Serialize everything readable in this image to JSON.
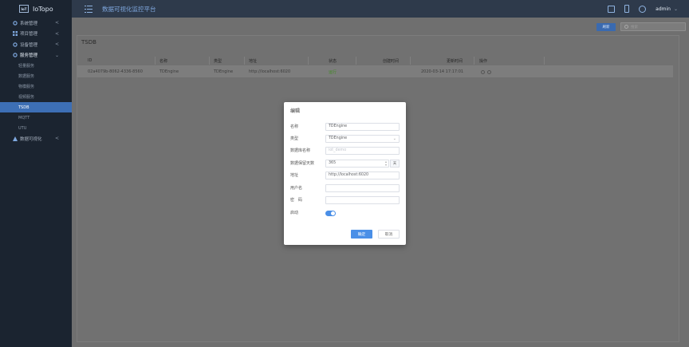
{
  "app": {
    "logo_badge": "IoT",
    "name": "IoTopo"
  },
  "header": {
    "title": "数据可视化监控平台",
    "user": "admin",
    "icons": [
      "monitor-icon",
      "phone-icon",
      "globe-icon"
    ]
  },
  "sidebar": {
    "items": [
      {
        "label": "系统管理",
        "icon": "gear-icon",
        "chevron": "<"
      },
      {
        "label": "项目管理",
        "icon": "grid-icon",
        "chevron": "<"
      },
      {
        "label": "设备管理",
        "icon": "gear-icon",
        "chevron": "<"
      },
      {
        "label": "服务管理",
        "icon": "gear-icon",
        "chevron": "v"
      }
    ],
    "sub_items": [
      "轻量服务",
      "数据服务",
      "物模服务",
      "视频服务",
      "TSDB",
      "MQTT",
      "UTU"
    ],
    "active_sub": "TSDB",
    "bottom_item": {
      "label": "数据可视化",
      "icon": "chart-icon",
      "chevron": "<"
    }
  },
  "toolbar": {
    "refresh_label": "刷新",
    "search_placeholder": "搜索"
  },
  "panel": {
    "title": "TSDB"
  },
  "table": {
    "columns": [
      "ID",
      "名称",
      "类型",
      "地址",
      "状态",
      "创建时间",
      "更新时间",
      "操作"
    ],
    "rows": [
      {
        "id": "02a4079b-8062-4336-8560",
        "name": "TDEngine",
        "type": "TDEngine",
        "address": "http://localhost:6020",
        "status": "运行",
        "created": "",
        "updated": "2020-03-14 17:17:01"
      }
    ]
  },
  "modal": {
    "title": "编辑",
    "fields": {
      "name": {
        "label": "名称",
        "value": "TDEngine"
      },
      "type": {
        "label": "类型",
        "value": "TDEngine"
      },
      "dbname": {
        "label": "数据库名称",
        "placeholder": "iot_demo"
      },
      "retention": {
        "label": "数据保留天数",
        "value": "365",
        "unit": "天"
      },
      "address": {
        "label": "地址",
        "value": "http://localhost:6020"
      },
      "username": {
        "label": "用户名",
        "value": ""
      },
      "password": {
        "label": "密　码",
        "value": ""
      },
      "enabled": {
        "label": "启动",
        "on": true
      }
    },
    "ok_label": "确定",
    "cancel_label": "取消"
  }
}
